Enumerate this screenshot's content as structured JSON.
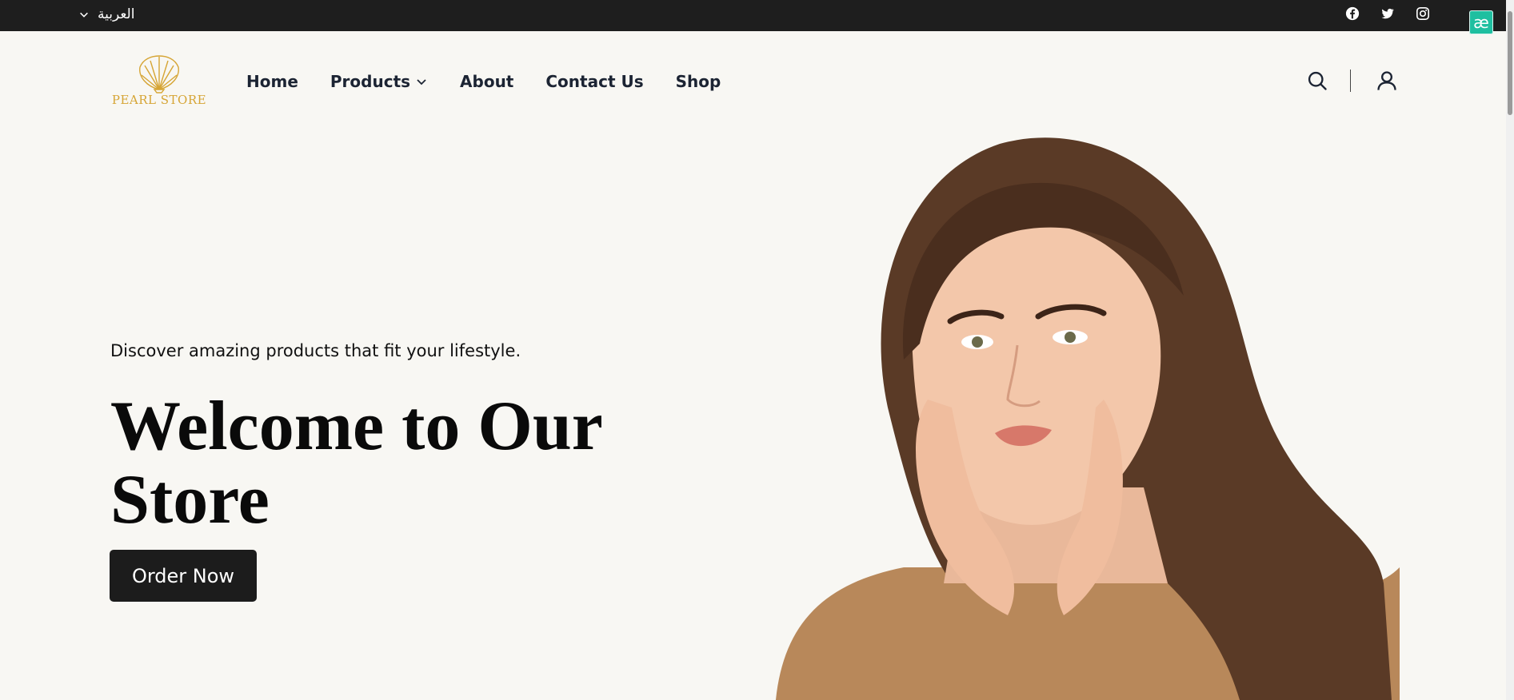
{
  "topbar": {
    "language": "العربية",
    "language_icon": "chevron-down-icon",
    "socials": [
      {
        "name": "facebook-icon"
      },
      {
        "name": "twitter-icon"
      },
      {
        "name": "instagram-icon"
      }
    ],
    "extension_icon": "æ"
  },
  "header": {
    "logo_text": "PEARL STORE",
    "logo_icon": "shell-icon",
    "brand_color": "#d6a535",
    "nav": {
      "home": "Home",
      "products": "Products",
      "about": "About",
      "contact": "Contact Us",
      "shop": "Shop"
    },
    "icons": [
      "search-icon",
      "user-icon"
    ]
  },
  "hero": {
    "tagline": "Discover amazing products that fit your lifestyle.",
    "title": "Welcome to Our Store",
    "button": "Order Now",
    "button_color": "#1c1c1c",
    "image": "model-portrait"
  },
  "colors": {
    "background": "#f8f7f3",
    "topbar": "#1e1e1e",
    "text": "#1c2433"
  }
}
